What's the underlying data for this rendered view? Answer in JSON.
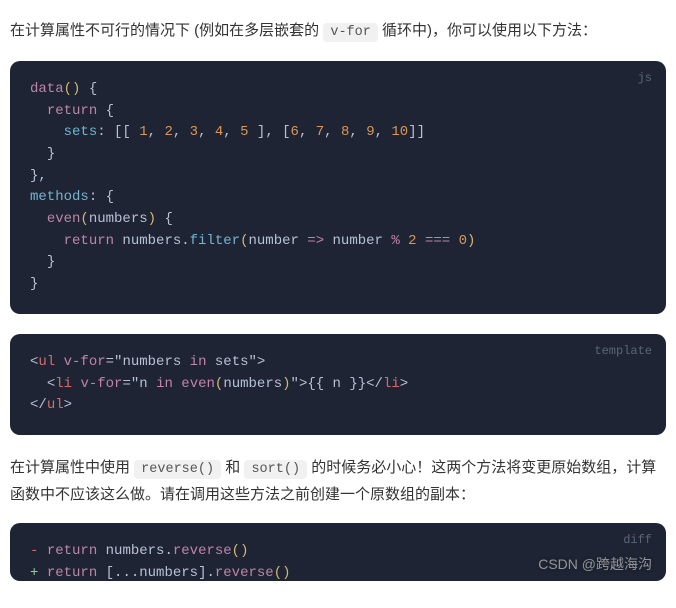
{
  "para1": {
    "t1": "在计算属性不可行的情况下 (例如在多层嵌套的 ",
    "code": "v-for",
    "t2": " 循环中)，你可以使用以下方法："
  },
  "block1": {
    "lang": "js",
    "lines": [
      [
        {
          "c": "tk-fn",
          "t": "data"
        },
        {
          "c": "tk-paren",
          "t": "()"
        },
        {
          "c": "tk-punc",
          "t": " {"
        }
      ],
      [
        {
          "c": "tk-plain",
          "t": "  "
        },
        {
          "c": "tk-kw",
          "t": "return"
        },
        {
          "c": "tk-punc",
          "t": " {"
        }
      ],
      [
        {
          "c": "tk-plain",
          "t": "    "
        },
        {
          "c": "tk-prop",
          "t": "sets"
        },
        {
          "c": "tk-punc",
          "t": ": [["
        },
        {
          "c": "tk-plain",
          "t": " "
        },
        {
          "c": "tk-num",
          "t": "1"
        },
        {
          "c": "tk-punc",
          "t": ", "
        },
        {
          "c": "tk-num",
          "t": "2"
        },
        {
          "c": "tk-punc",
          "t": ", "
        },
        {
          "c": "tk-num",
          "t": "3"
        },
        {
          "c": "tk-punc",
          "t": ", "
        },
        {
          "c": "tk-num",
          "t": "4"
        },
        {
          "c": "tk-punc",
          "t": ", "
        },
        {
          "c": "tk-num",
          "t": "5"
        },
        {
          "c": "tk-punc",
          "t": " ], ["
        },
        {
          "c": "tk-num",
          "t": "6"
        },
        {
          "c": "tk-punc",
          "t": ", "
        },
        {
          "c": "tk-num",
          "t": "7"
        },
        {
          "c": "tk-punc",
          "t": ", "
        },
        {
          "c": "tk-num",
          "t": "8"
        },
        {
          "c": "tk-punc",
          "t": ", "
        },
        {
          "c": "tk-num",
          "t": "9"
        },
        {
          "c": "tk-punc",
          "t": ", "
        },
        {
          "c": "tk-num",
          "t": "10"
        },
        {
          "c": "tk-punc",
          "t": "]]"
        }
      ],
      [
        {
          "c": "tk-plain",
          "t": "  "
        },
        {
          "c": "tk-punc",
          "t": "}"
        }
      ],
      [
        {
          "c": "tk-punc",
          "t": "},"
        }
      ],
      [
        {
          "c": "tk-prop",
          "t": "methods"
        },
        {
          "c": "tk-punc",
          "t": ": {"
        }
      ],
      [
        {
          "c": "tk-plain",
          "t": "  "
        },
        {
          "c": "tk-fn",
          "t": "even"
        },
        {
          "c": "tk-paren",
          "t": "("
        },
        {
          "c": "tk-id",
          "t": "numbers"
        },
        {
          "c": "tk-paren",
          "t": ")"
        },
        {
          "c": "tk-punc",
          "t": " {"
        }
      ],
      [
        {
          "c": "tk-plain",
          "t": "    "
        },
        {
          "c": "tk-kw",
          "t": "return"
        },
        {
          "c": "tk-id",
          "t": " numbers"
        },
        {
          "c": "tk-punc",
          "t": "."
        },
        {
          "c": "tk-call",
          "t": "filter"
        },
        {
          "c": "tk-paren",
          "t": "("
        },
        {
          "c": "tk-id",
          "t": "number "
        },
        {
          "c": "tk-op",
          "t": "=>"
        },
        {
          "c": "tk-id",
          "t": " number "
        },
        {
          "c": "tk-op",
          "t": "%"
        },
        {
          "c": "tk-plain",
          "t": " "
        },
        {
          "c": "tk-num",
          "t": "2"
        },
        {
          "c": "tk-plain",
          "t": " "
        },
        {
          "c": "tk-op",
          "t": "==="
        },
        {
          "c": "tk-plain",
          "t": " "
        },
        {
          "c": "tk-num",
          "t": "0"
        },
        {
          "c": "tk-paren",
          "t": ")"
        }
      ],
      [
        {
          "c": "tk-plain",
          "t": "  "
        },
        {
          "c": "tk-punc",
          "t": "}"
        }
      ],
      [
        {
          "c": "tk-punc",
          "t": "}"
        }
      ]
    ]
  },
  "block2": {
    "lang": "template",
    "lines": [
      [
        {
          "c": "tk-punc",
          "t": "<"
        },
        {
          "c": "tk-tag",
          "t": "ul"
        },
        {
          "c": "tk-plain",
          "t": " "
        },
        {
          "c": "tk-attr",
          "t": "v-for"
        },
        {
          "c": "tk-punc",
          "t": "="
        },
        {
          "c": "tk-punc",
          "t": "\""
        },
        {
          "c": "tk-id",
          "t": "numbers "
        },
        {
          "c": "tk-kw",
          "t": "in"
        },
        {
          "c": "tk-id",
          "t": " sets"
        },
        {
          "c": "tk-punc",
          "t": "\""
        },
        {
          "c": "tk-punc",
          "t": ">"
        }
      ],
      [
        {
          "c": "tk-plain",
          "t": "  "
        },
        {
          "c": "tk-punc",
          "t": "<"
        },
        {
          "c": "tk-tag",
          "t": "li"
        },
        {
          "c": "tk-plain",
          "t": " "
        },
        {
          "c": "tk-attr",
          "t": "v-for"
        },
        {
          "c": "tk-punc",
          "t": "="
        },
        {
          "c": "tk-punc",
          "t": "\""
        },
        {
          "c": "tk-id",
          "t": "n "
        },
        {
          "c": "tk-kw",
          "t": "in"
        },
        {
          "c": "tk-plain",
          "t": " "
        },
        {
          "c": "tk-fn",
          "t": "even"
        },
        {
          "c": "tk-paren",
          "t": "("
        },
        {
          "c": "tk-id",
          "t": "numbers"
        },
        {
          "c": "tk-paren",
          "t": ")"
        },
        {
          "c": "tk-punc",
          "t": "\""
        },
        {
          "c": "tk-punc",
          "t": ">"
        },
        {
          "c": "tk-plain",
          "t": "{{ n }}"
        },
        {
          "c": "tk-punc",
          "t": "</"
        },
        {
          "c": "tk-tag",
          "t": "li"
        },
        {
          "c": "tk-punc",
          "t": ">"
        }
      ],
      [
        {
          "c": "tk-punc",
          "t": "</"
        },
        {
          "c": "tk-tag",
          "t": "ul"
        },
        {
          "c": "tk-punc",
          "t": ">"
        }
      ]
    ]
  },
  "para2": {
    "t1": "在计算属性中使用 ",
    "c1": "reverse()",
    "t2": " 和 ",
    "c2": "sort()",
    "t3": " 的时候务必小心！这两个方法将变更原始数组，计算函数中不应该这么做。请在调用这些方法之前创建一个原数组的副本："
  },
  "block3": {
    "lang": "diff",
    "lines": [
      [
        {
          "c": "diff-minus",
          "t": "- "
        },
        {
          "c": "tk-kw",
          "t": "return"
        },
        {
          "c": "tk-id",
          "t": " numbers"
        },
        {
          "c": "tk-punc",
          "t": "."
        },
        {
          "c": "tk-fn",
          "t": "reverse"
        },
        {
          "c": "tk-paren",
          "t": "()"
        }
      ],
      [
        {
          "c": "diff-plus",
          "t": "+ "
        },
        {
          "c": "tk-kw",
          "t": "return"
        },
        {
          "c": "tk-plain",
          "t": " "
        },
        {
          "c": "tk-punc",
          "t": "[..."
        },
        {
          "c": "tk-id",
          "t": "numbers"
        },
        {
          "c": "tk-punc",
          "t": "]."
        },
        {
          "c": "tk-fn",
          "t": "reverse"
        },
        {
          "c": "tk-paren",
          "t": "()"
        }
      ]
    ]
  },
  "watermark": "CSDN @跨越海沟"
}
